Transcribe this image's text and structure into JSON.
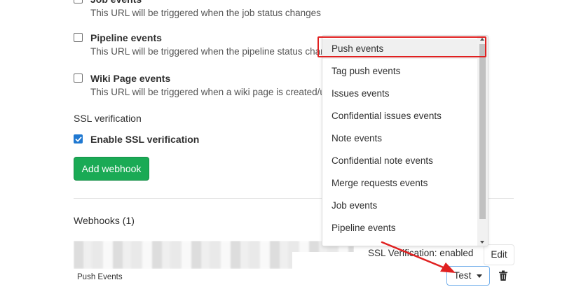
{
  "options": [
    {
      "title": "Job events",
      "desc": "This URL will be triggered when the job status changes",
      "checked": false
    },
    {
      "title": "Pipeline events",
      "desc": "This URL will be triggered when the pipeline status changes",
      "checked": false
    },
    {
      "title": "Wiki Page events",
      "desc": "This URL will be triggered when a wiki page is created/updated",
      "checked": false
    }
  ],
  "ssl": {
    "heading": "SSL verification",
    "checkbox_label": "Enable SSL verification",
    "checked": true
  },
  "add_webhook_button": "Add webhook",
  "webhooks": {
    "title": "Webhooks (1)",
    "item": {
      "ssl_status": "SSL Verification: enabled",
      "edit_label": "Edit",
      "events_label": "Push Events",
      "test_label": "Test"
    }
  },
  "test_dropdown": {
    "items": [
      "Push events",
      "Tag push events",
      "Issues events",
      "Confidential issues events",
      "Note events",
      "Confidential note events",
      "Merge requests events",
      "Job events",
      "Pipeline events"
    ],
    "highlighted_index": 0
  },
  "colors": {
    "primary_green": "#1aaa55",
    "checkbox_blue": "#1f78d1",
    "annotation_red": "#e02020"
  },
  "icons": {
    "trash": "trash-icon",
    "caret": "caret-down-icon",
    "check": "check-icon"
  }
}
